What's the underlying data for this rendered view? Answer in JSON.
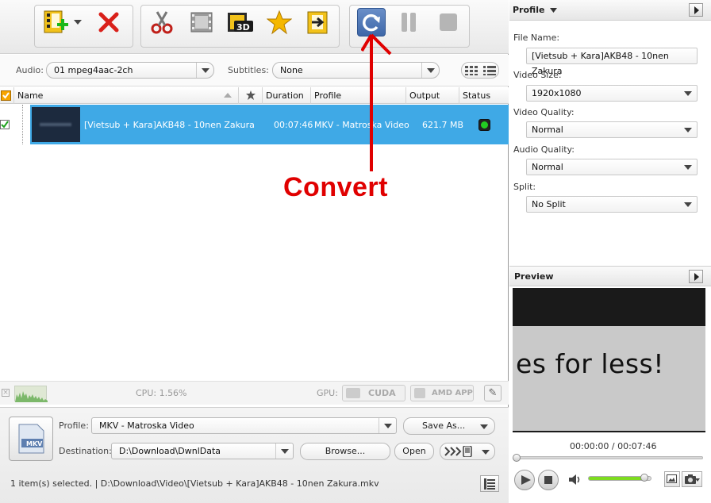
{
  "toolbar": {
    "buttons": [
      "add-video",
      "dropdown",
      "remove",
      "clip",
      "effects",
      "3d",
      "favorite",
      "add-output",
      "convert",
      "pause",
      "stop"
    ]
  },
  "options": {
    "audio_label": "Audio:",
    "audio_value": "01 mpeg4aac-2ch",
    "subtitles_label": "Subtitles:",
    "subtitles_value": "None"
  },
  "table": {
    "headers": {
      "name": "Name",
      "duration": "Duration",
      "profile": "Profile",
      "output_size": "Output Size",
      "status": "Status"
    },
    "rows": [
      {
        "name": "[Vietsub + Kara]AKB48 - 10nen Zakura",
        "duration": "00:07:46",
        "profile": "MKV - Matroska Video",
        "output_size": "621.7 MB"
      }
    ]
  },
  "annotation": {
    "text": "Convert",
    "color": "#e00000"
  },
  "gpu_bar": {
    "cpu_label": "CPU: 1.56%",
    "gpu_label": "GPU:",
    "cuda_label": "CUDA",
    "amd_label": "AMD APP"
  },
  "bottom": {
    "profile_label": "Profile:",
    "profile_value": "MKV - Matroska Video",
    "save_as_label": "Save As...",
    "destination_label": "Destination:",
    "destination_value": "D:\\Download\\DwnlData",
    "browse_label": "Browse...",
    "open_label": "Open",
    "badge": "MKV",
    "status_text": "1 item(s) selected. | D:\\Download\\Video\\[Vietsub + Kara]AKB48 - 10nen Zakura.mkv"
  },
  "profile_panel": {
    "title": "Profile",
    "file_name_label": "File Name:",
    "file_name_value": "[Vietsub + Kara]AKB48 - 10nen Zakura",
    "video_size_label": "Video Size:",
    "video_size_value": "1920x1080",
    "video_quality_label": "Video Quality:",
    "video_quality_value": "Normal",
    "audio_quality_label": "Audio Quality:",
    "audio_quality_value": "Normal",
    "split_label": "Split:",
    "split_value": "No Split"
  },
  "preview_panel": {
    "title": "Preview",
    "frame_text": "es for less!",
    "time_display": "00:00:00 / 00:07:46",
    "volume_level": 0.9
  },
  "colors": {
    "selection": "#3fa9e6",
    "accent": "#3e67a8",
    "status_ok": "#22cc22",
    "volume": "#7ddc1f"
  }
}
